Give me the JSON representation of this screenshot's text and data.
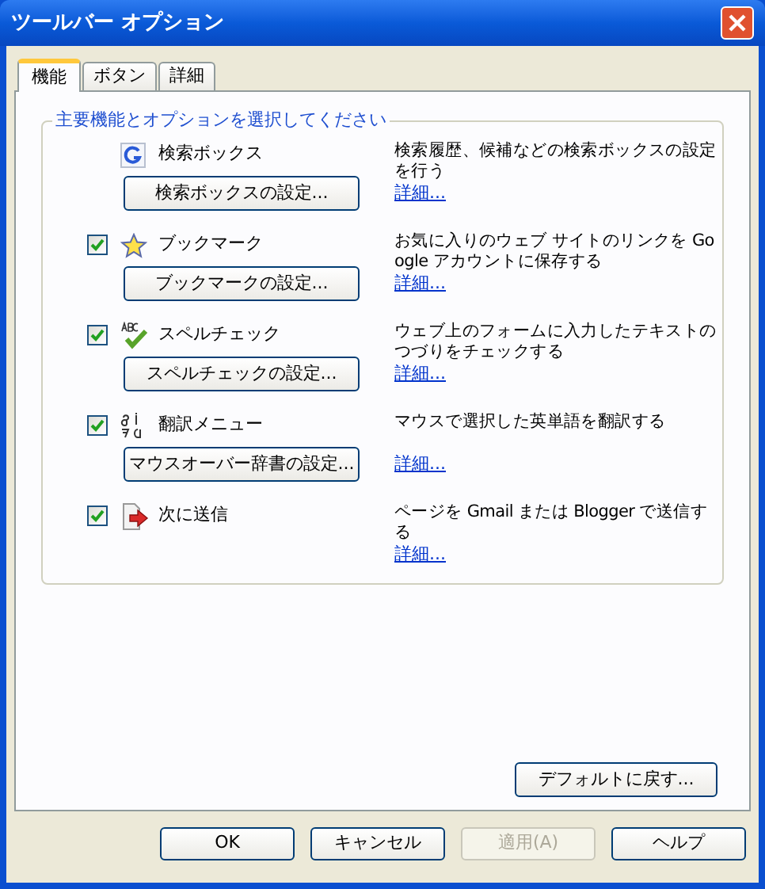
{
  "window": {
    "title": "ツールバー オプション"
  },
  "tabs": [
    {
      "label": "機能",
      "selected": true
    },
    {
      "label": "ボタン",
      "selected": false
    },
    {
      "label": "詳細",
      "selected": false
    }
  ],
  "group": {
    "title": "主要機能とオプションを選択してください"
  },
  "features": [
    {
      "kind": "fixed",
      "label": "検索ボックス",
      "button": "検索ボックスの設定...",
      "description": "検索履歴、候補などの検索ボックスの設定を行う",
      "link": "詳細..."
    },
    {
      "kind": "toggle",
      "checked": true,
      "label": "ブックマーク",
      "button": "ブックマークの設定...",
      "description": "お気に入りのウェブ サイトのリンクを Google アカウントに保存する",
      "link": "詳細..."
    },
    {
      "kind": "toggle",
      "checked": true,
      "label": "スペルチェック",
      "button": "スペルチェックの設定...",
      "description": "ウェブ上のフォームに入力したテキストのつづりをチェックする",
      "link": "詳細..."
    },
    {
      "kind": "toggle",
      "checked": true,
      "label": "翻訳メニュー",
      "button": "マウスオーバー辞書の設定...",
      "description": "マウスで選択した英単語を翻訳する",
      "link": "詳細..."
    },
    {
      "kind": "toggle",
      "checked": true,
      "label": "次に送信",
      "description": "ページを Gmail または Blogger で送信する",
      "link": "詳細..."
    }
  ],
  "reset_button": "デフォルトに戻す...",
  "buttons": [
    {
      "label": "OK",
      "disabled": false
    },
    {
      "label": "キャンセル",
      "disabled": false
    },
    {
      "label": "適用(A)",
      "disabled": true
    },
    {
      "label": "ヘルプ",
      "disabled": false
    }
  ]
}
